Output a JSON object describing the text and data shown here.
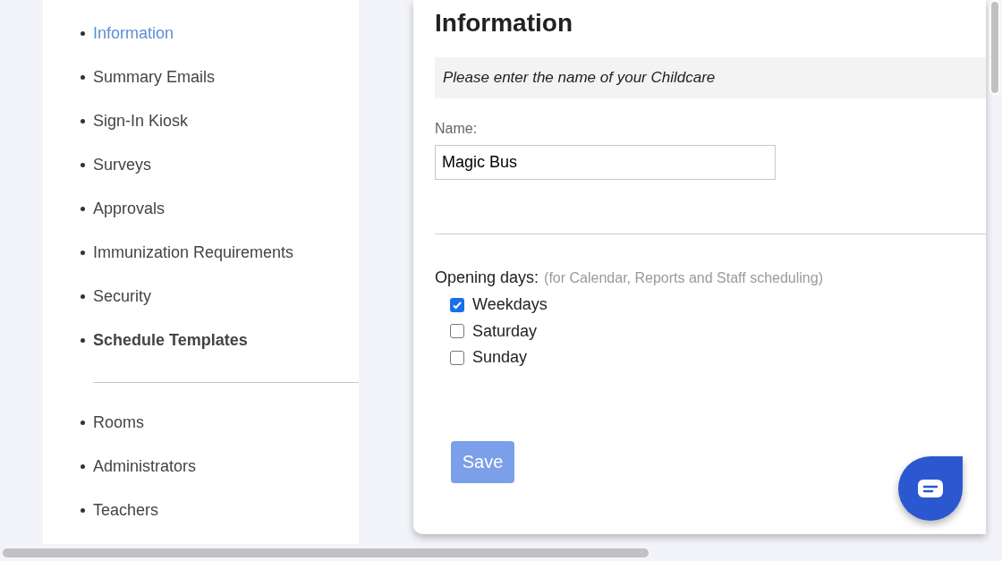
{
  "sidebar": {
    "groups": [
      {
        "items": [
          {
            "label": "Information",
            "selected": true,
            "bold": false
          },
          {
            "label": "Summary Emails",
            "selected": false,
            "bold": false
          },
          {
            "label": "Sign-In Kiosk",
            "selected": false,
            "bold": false
          },
          {
            "label": "Surveys",
            "selected": false,
            "bold": false
          },
          {
            "label": "Approvals",
            "selected": false,
            "bold": false
          },
          {
            "label": "Immunization Requirements",
            "selected": false,
            "bold": false
          },
          {
            "label": "Security",
            "selected": false,
            "bold": false
          },
          {
            "label": "Schedule Templates",
            "selected": false,
            "bold": true
          }
        ]
      },
      {
        "items": [
          {
            "label": "Rooms",
            "selected": false,
            "bold": false
          },
          {
            "label": "Administrators",
            "selected": false,
            "bold": false
          },
          {
            "label": "Teachers",
            "selected": false,
            "bold": false
          }
        ]
      }
    ]
  },
  "panel": {
    "title": "Information",
    "hint": "Please enter the name of your Childcare",
    "name_field": {
      "label": "Name:",
      "value": "Magic Bus"
    },
    "opening_days": {
      "label": "Opening days:",
      "note": "(for Calendar, Reports and Staff scheduling)",
      "options": [
        {
          "label": "Weekdays",
          "checked": true
        },
        {
          "label": "Saturday",
          "checked": false
        },
        {
          "label": "Sunday",
          "checked": false
        }
      ]
    },
    "save_button": "Save"
  }
}
